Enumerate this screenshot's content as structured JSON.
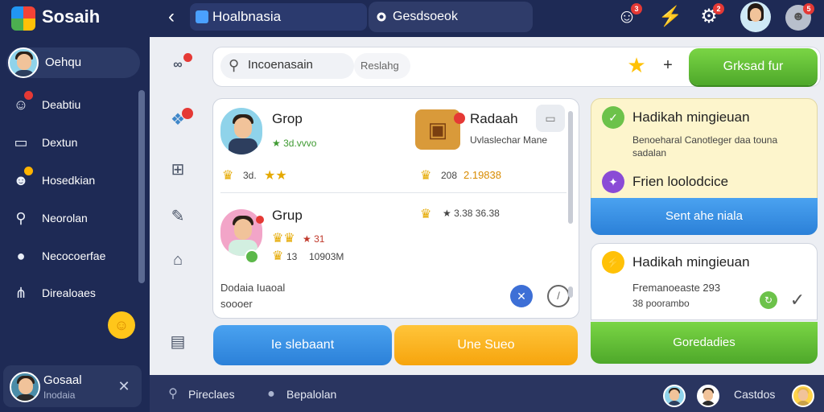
{
  "header": {
    "app_title": "Sosaih",
    "back_icon": "arrow-left-icon",
    "tab_active": "Hoalbnasia",
    "tab_second": "Gesdsoeok",
    "badges": {
      "notify": "3",
      "settings": "2",
      "chat": "5"
    }
  },
  "sidebar": {
    "user_label": "Oehqu",
    "items": [
      {
        "label": "Deabtiu",
        "icon": "face-icon"
      },
      {
        "label": "Dextun",
        "icon": "inbox-icon"
      },
      {
        "label": "Hosedkian",
        "icon": "trophy-icon"
      },
      {
        "label": "Neorolan",
        "icon": "key-icon"
      },
      {
        "label": "Necocoerfae",
        "icon": "chat-icon"
      },
      {
        "label": "Direaloaes",
        "icon": "share-icon"
      }
    ],
    "profile_name": "Gosaal",
    "profile_status": "Inodaia"
  },
  "search": {
    "value": "Incoenasain",
    "chip": "Reslahg",
    "primary_button": "Grksad fur"
  },
  "groups": {
    "item1_title": "Grop",
    "item1_score": "★ 3d.vvvo",
    "item1_coins": "3d.",
    "item2_title": "Radaah",
    "item2_desc": "Uvlaslechar Mane",
    "item2_coins": "208",
    "item2_points": "2.19838",
    "item3_title": "Grup",
    "item3_stars": "★ 31",
    "item3_value": "13",
    "item3_extra": "10903M",
    "item3_coin_row": "★ 3.38 36.38",
    "footer_title": "Dodaia Iuaoal",
    "footer_sub": "soooer"
  },
  "actions": {
    "blue": "Ie slebaant",
    "orange": "Une Sueo"
  },
  "rewards": {
    "card1_title": "Hadikah mingieuan",
    "card1_desc": "Benoeharal Canotleger daa touna sadalan",
    "card1_subtitle": "Frien loolodcice",
    "card1_button": "Sent ahe niala",
    "card2_title": "Hadikah mingieuan",
    "card2_line1": "Fremanoeaste 293",
    "card2_line2": "38 poorambo",
    "card2_button": "Goredadies"
  },
  "bottom_bar": {
    "item1": "Pireclaes",
    "item2": "Bepalolan",
    "item3": "Castdos"
  },
  "colors": {
    "header": "#1e2a55",
    "accent_green": "#4ea82a",
    "accent_blue": "#2b80d8",
    "accent_orange": "#f6a40d"
  }
}
